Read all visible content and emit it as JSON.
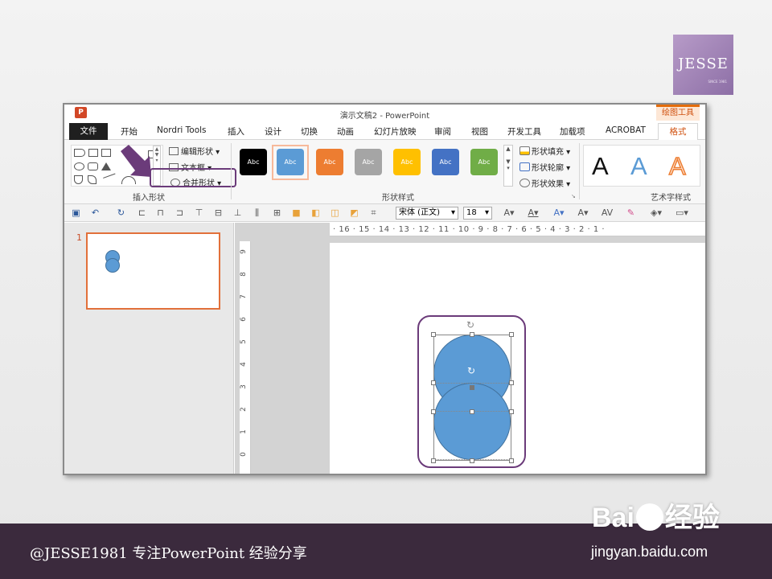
{
  "logo": {
    "name": "JESSE",
    "tagline": "SINCE 1981"
  },
  "window": {
    "app_icon": "P",
    "title": "演示文稿2 - PowerPoint",
    "context_tool": "绘图工具"
  },
  "tabs": [
    {
      "label": "文件"
    },
    {
      "label": "开始"
    },
    {
      "label": "Nordri Tools"
    },
    {
      "label": "插入"
    },
    {
      "label": "设计"
    },
    {
      "label": "切换"
    },
    {
      "label": "动画"
    },
    {
      "label": "幻灯片放映"
    },
    {
      "label": "审阅"
    },
    {
      "label": "视图"
    },
    {
      "label": "开发工具"
    },
    {
      "label": "加载项"
    },
    {
      "label": "ACROBAT"
    },
    {
      "label": "格式"
    }
  ],
  "ribbon": {
    "insert_shapes": {
      "edit_shape": "编辑形状",
      "text_box": "文本框",
      "merge_shapes": "合并形状",
      "group_label": "插入形状"
    },
    "shape_styles": {
      "swatches": [
        {
          "text": "Abc",
          "color": "#000000"
        },
        {
          "text": "Abc",
          "color": "#5b9bd5"
        },
        {
          "text": "Abc",
          "color": "#ed7d31"
        },
        {
          "text": "Abc",
          "color": "#a5a5a5"
        },
        {
          "text": "Abc",
          "color": "#ffc000"
        },
        {
          "text": "Abc",
          "color": "#4472c4"
        },
        {
          "text": "Abc",
          "color": "#70ad47"
        }
      ],
      "fill": "形状填充",
      "outline": "形状轮廓",
      "effects": "形状效果",
      "group_label": "形状样式"
    },
    "wordart": {
      "samples": [
        {
          "text": "A",
          "color": "#111111"
        },
        {
          "text": "A",
          "color": "#5b9bd5"
        },
        {
          "text": "A",
          "color": "#ed7d31"
        }
      ],
      "group_label": "艺术字样式"
    }
  },
  "qat": {
    "font": "宋体 (正文)",
    "size": "18"
  },
  "ruler": {
    "horizontal": "· 16 · 15 · 14 · 13 · 12 · 11 · 10 · 9 · 8 · 7 · 6 · 5 · 4 · 3 · 2 · 1 ·",
    "vertical": [
      "9",
      "8",
      "7",
      "6",
      "5",
      "4",
      "3",
      "2",
      "1",
      "0"
    ]
  },
  "thumbnails": {
    "slide_number": "1"
  },
  "footer": {
    "credit": "@JESSE1981 专注PowerPoint 经验分享",
    "baidu_a": "Bai",
    "baidu_b": "经验",
    "site": "jingyan.baidu.com"
  },
  "colors": {
    "accent_purple": "#6b3b7a",
    "shape_blue": "#5b9bd5",
    "format_orange": "#d0500e",
    "footer_bg": "#3b2a3d"
  }
}
